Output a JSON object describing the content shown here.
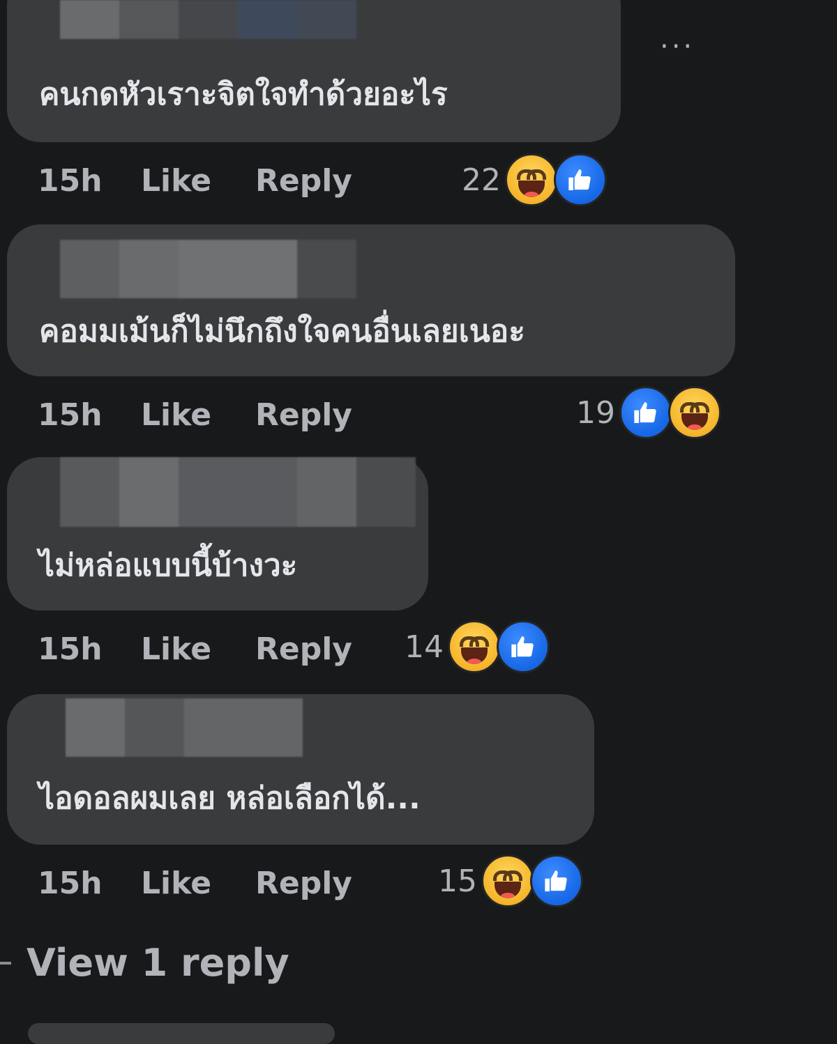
{
  "colors": {
    "background": "#18191a",
    "bubble": "#3a3b3c",
    "text": "#e4e6eb",
    "muted": "#b0b3b8",
    "like_blue": "#1877f2",
    "haha_yellow": "#f7b928"
  },
  "more_options_label": "···",
  "comments": [
    {
      "text": "คนกดหัวเราะจิตใจทำด้วยอะไร",
      "time": "15h",
      "like_label": "Like",
      "reply_label": "Reply",
      "reaction_count": "22",
      "reactions": [
        "haha-icon",
        "like-icon"
      ]
    },
    {
      "text": "คอมมเม้นก็ไม่นึกถึงใจคนอื่นเลยเนอะ",
      "time": "15h",
      "like_label": "Like",
      "reply_label": "Reply",
      "reaction_count": "19",
      "reactions": [
        "like-icon",
        "haha-icon"
      ]
    },
    {
      "text": "ไม่หล่อแบบนี้บ้างวะ",
      "time": "15h",
      "like_label": "Like",
      "reply_label": "Reply",
      "reaction_count": "14",
      "reactions": [
        "haha-icon",
        "like-icon"
      ]
    },
    {
      "text": "ไอดอลผมเลย หล่อเลือกได้...",
      "time": "15h",
      "like_label": "Like",
      "reply_label": "Reply",
      "reaction_count": "15",
      "reactions": [
        "haha-icon",
        "like-icon"
      ]
    }
  ],
  "view_replies_label": "View 1 reply"
}
